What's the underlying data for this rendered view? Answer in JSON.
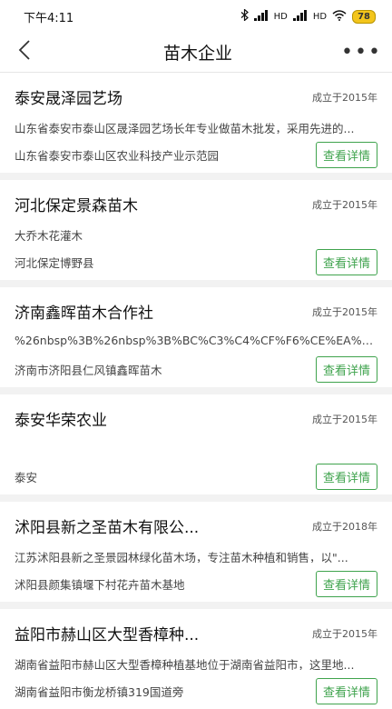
{
  "status": {
    "time": "下午4:11",
    "signal1": "HD",
    "signal2": "HD",
    "battery": "78"
  },
  "nav": {
    "title": "苗木企业",
    "more": "•••"
  },
  "detail_label": "查看详情",
  "items": [
    {
      "name": "泰安晟泽园艺场",
      "date": "成立于2015年",
      "desc": "山东省泰安市泰山区晟泽园艺场长年专业做苗木批发，采用先进的...",
      "addr": "山东省泰安市泰山区农业科技产业示范园"
    },
    {
      "name": "河北保定景森苗木",
      "date": "成立于2015年",
      "desc": "大乔木花灌木",
      "addr": "河北保定博野县"
    },
    {
      "name": "济南鑫晖苗木合作社",
      "date": "成立于2015年",
      "desc": "%26nbsp%3B%26nbsp%3B%BC%C3%C4%CF%F6%CE%EA%CD%C3...",
      "addr": "济南市济阳县仁风镇鑫晖苗木"
    },
    {
      "name": "泰安华荣农业",
      "date": "成立于2015年",
      "desc": "",
      "addr": "泰安"
    },
    {
      "name": "沭阳县新之圣苗木有限公...",
      "date": "成立于2018年",
      "desc": "江苏沭阳县新之圣景园林绿化苗木场，专注苗木种植和销售，以\"...",
      "addr": "沭阳县颜集镇堰下村花卉苗木基地"
    },
    {
      "name": "益阳市赫山区大型香樟种...",
      "date": "成立于2015年",
      "desc": "湖南省益阳市赫山区大型香樟种植基地位于湖南省益阳市，这里地...",
      "addr": "湖南省益阳市衡龙桥镇319国道旁"
    }
  ]
}
